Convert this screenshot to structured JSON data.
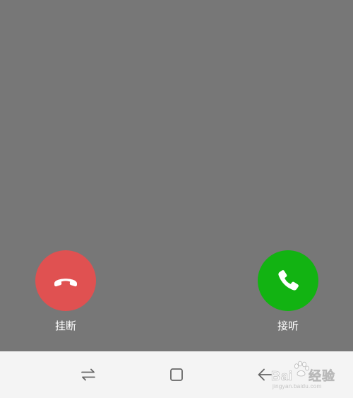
{
  "call": {
    "decline_label": "挂断",
    "answer_label": "接听",
    "decline_color": "#e05151",
    "answer_color": "#12b312",
    "background_color": "#777777"
  },
  "navbar": {
    "background_color": "#f4f4f4",
    "icons": [
      "swap-arrows-icon",
      "square-home-icon",
      "back-arrow-icon"
    ]
  },
  "watermark": {
    "brand": "Bai",
    "brand_suffix": "经验",
    "sub": "jingyan.baidu.com"
  }
}
